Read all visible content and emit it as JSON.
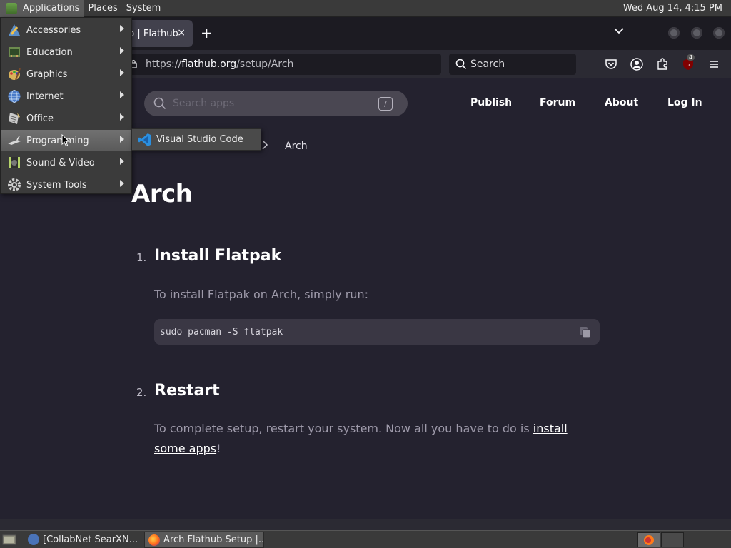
{
  "top_panel": {
    "menus": [
      "Applications",
      "Places",
      "System"
    ],
    "clock": "Wed Aug 14,  4:15 PM"
  },
  "browser": {
    "active_tab_title": "p | Flathub",
    "tab_close": "×",
    "new_tab": "+",
    "url_scheme": "https://",
    "url_host": "flathub.org",
    "url_path": "/setup/Arch",
    "search_placeholder": "Search",
    "ublock_count": "4"
  },
  "site": {
    "search_placeholder": "Search apps",
    "search_shortcut": "/",
    "nav": [
      "Publish",
      "Forum",
      "About",
      "Log In"
    ],
    "breadcrumb_current": "Arch",
    "title": "Arch",
    "steps": [
      {
        "number": "1.",
        "heading": "Install Flatpak",
        "text": "To install Flatpak on Arch, simply run:",
        "code": "sudo pacman -S flatpak"
      },
      {
        "number": "2.",
        "heading": "Restart",
        "text_before": "To complete setup, restart your system. Now all you have to do is ",
        "link": "install some apps",
        "text_after": "!"
      }
    ]
  },
  "apps_menu": {
    "categories": [
      "Accessories",
      "Education",
      "Graphics",
      "Internet",
      "Office",
      "Programming",
      "Sound & Video",
      "System Tools"
    ],
    "active_category": "Programming",
    "submenu_item": "Visual Studio Code"
  },
  "taskbar": {
    "windows": [
      "[CollabNet SearXN...",
      "Arch Flathub Setup |..."
    ]
  },
  "colors": {
    "page_bg": "#24222f",
    "panel_bg": "#3a3a3a",
    "firefox_bg": "#1c1b22"
  }
}
